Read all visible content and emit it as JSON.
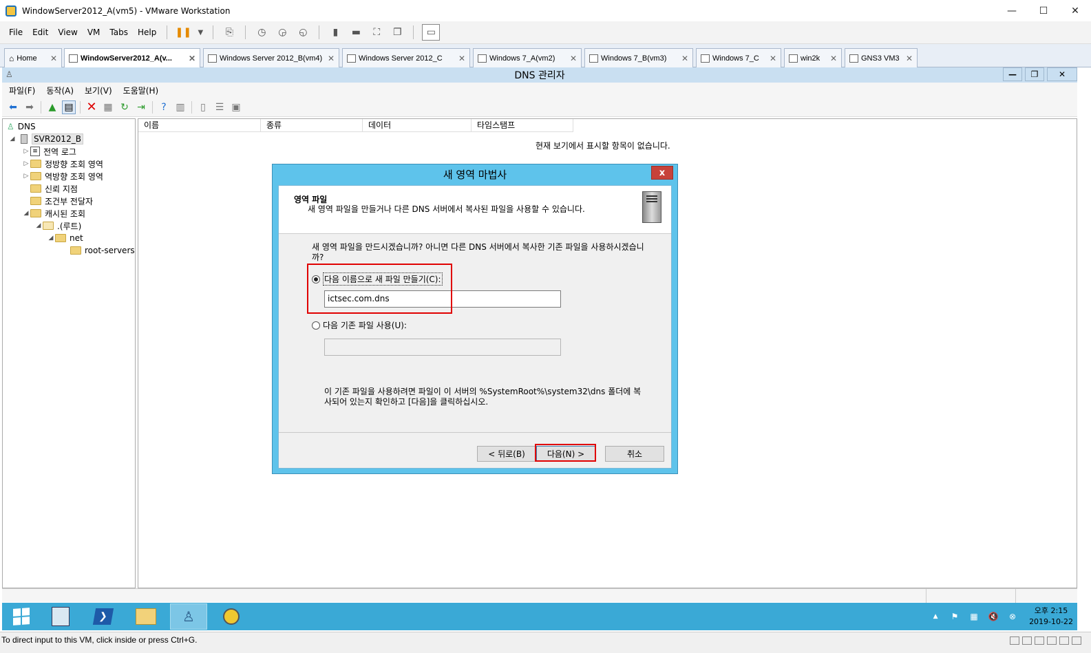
{
  "vmware": {
    "title": "WindowServer2012_A(vm5) - VMware Workstation",
    "menu": [
      "File",
      "Edit",
      "View",
      "VM",
      "Tabs",
      "Help"
    ],
    "tabs": [
      {
        "label": "Home",
        "active": false
      },
      {
        "label": "WindowServer2012_A(v...",
        "active": true
      },
      {
        "label": "Windows Server 2012_B(vm4)",
        "active": false
      },
      {
        "label": "Windows Server 2012_C",
        "active": false
      },
      {
        "label": "Windows 7_A(vm2)",
        "active": false
      },
      {
        "label": "Windows 7_B(vm3)",
        "active": false
      },
      {
        "label": "Windows 7_C",
        "active": false
      },
      {
        "label": "win2k",
        "active": false
      },
      {
        "label": "GNS3 VM3",
        "active": false
      }
    ],
    "status_text": "To direct input to this VM, click inside or press Ctrl+G."
  },
  "dns_manager": {
    "title": "DNS 관리자",
    "menu": [
      "파일(F)",
      "동작(A)",
      "보기(V)",
      "도움말(H)"
    ],
    "tree": {
      "root": "DNS",
      "server": "SVR2012_B",
      "global_logs": "전역 로그",
      "forward_zones": "정방향 조회 영역",
      "reverse_zones": "역방향 조회 영역",
      "trust_points": "신뢰 지점",
      "conditional_forwarders": "조건부 전달자",
      "cached_lookups": "캐시된 조회",
      "root_node": ".(루트)",
      "net": "net",
      "root_servers": "root-servers"
    },
    "columns": [
      "이름",
      "종류",
      "데이터",
      "타임스탬프"
    ],
    "empty_message": "현재 보기에서 표시할 항목이 없습니다."
  },
  "wizard": {
    "title": "새 영역 마법사",
    "close_label": "x",
    "heading": "영역 파일",
    "subheading": "새 영역 파일을 만들거나 다른 DNS 서버에서 복사된 파일을 사용할 수 있습니다.",
    "question": "새 영역 파일을 만드시겠습니까? 아니면 다른 DNS 서버에서 복사한 기존 파일을 사용하시겠습니까?",
    "option_new_label": "다음 이름으로 새 파일 만들기(C):",
    "option_new_selected": true,
    "new_file_value": "ictsec.com.dns",
    "option_existing_label": "다음 기존 파일 사용(U):",
    "existing_file_value": "",
    "hint": "이 기존 파일을 사용하려면 파일이 이 서버의 %SystemRoot%\\system32\\dns 폴더에 복사되어 있는지 확인하고 [다음]을 클릭하십시오.",
    "back_label": "< 뒤로(B)",
    "next_label": "다음(N) >",
    "cancel_label": "취소"
  },
  "taskbar": {
    "time": "오후 2:15",
    "date": "2019-10-22"
  },
  "colors": {
    "taskbar": "#3aa9d6",
    "dialog_frame": "#5ec3eb",
    "highlight": "#e00000"
  }
}
